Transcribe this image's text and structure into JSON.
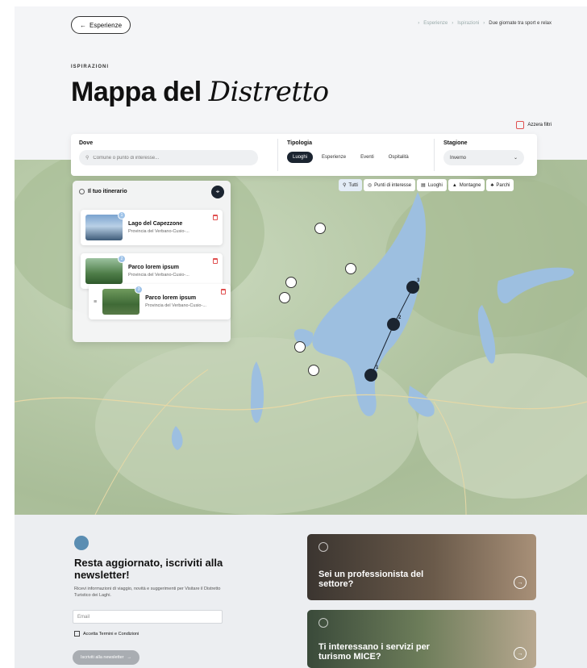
{
  "header": {
    "back_label": "Esperienze",
    "breadcrumbs": [
      "Esperienze",
      "Ispirazioni",
      "Due giornate tra sport e relax"
    ],
    "eyebrow": "ISPIRAZIONI",
    "title_bold": "Mappa del",
    "title_serif": "Distretto",
    "reset_label": "Azzera filtri"
  },
  "filters": {
    "dove_label": "Dove",
    "search_placeholder": "Comune o punto di interesse...",
    "tipologia_label": "Tipologia",
    "tipologia_options": [
      "Luoghi",
      "Esperienze",
      "Eventi",
      "Ospitalità"
    ],
    "tipologia_selected": "Luoghi",
    "stagione_label": "Stagione",
    "stagione_value": "Inverno"
  },
  "map_chips": [
    "Tutti",
    "Punti di interesse",
    "Luoghi",
    "Montagne",
    "Parchi"
  ],
  "map_chips_active": "Tutti",
  "itinerary": {
    "title": "Il tuo itinerario",
    "items": [
      {
        "num": "1",
        "name": "Lago del Capezzone",
        "sub": "Provincia del Verbano-Cusio-..."
      },
      {
        "num": "2",
        "name": "Parco lorem ipsum",
        "sub": "Provincia del Verbano-Cusio-..."
      },
      {
        "num": "3",
        "name": "Parco lorem ipsum",
        "sub": "Provincia del Verbano-Cusio-..."
      }
    ]
  },
  "map_markers": [
    "1",
    "2",
    "3"
  ],
  "newsletter": {
    "title": "Resta aggiornato, iscriviti alla newsletter!",
    "text": "Ricevi informazioni di viaggio, novità e suggerimenti per Visitare il Distretto Turistico dei Laghi.",
    "email_placeholder": "Email",
    "terms_label": "Accetta Termini e Condizioni",
    "submit_label": "Iscriviti alla newsletter"
  },
  "promos": [
    {
      "title": "Sei un professionista del settore?"
    },
    {
      "title": "Ti interessano i servizi per turismo MICE?"
    }
  ],
  "colors": {
    "accent_dark": "#1b2430",
    "water": "#9dbfe0",
    "delete_red": "#e05050"
  }
}
